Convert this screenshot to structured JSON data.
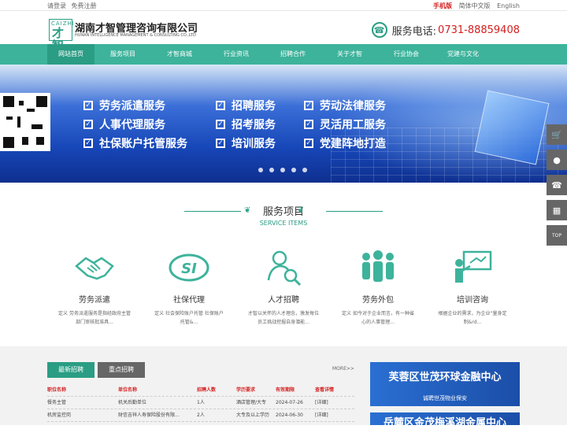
{
  "topbar": {
    "login": "请登录",
    "register": "免费注册",
    "mobile": "手机版",
    "lang_cn": "简体中文版",
    "lang_en": "English"
  },
  "logo": {
    "mark_text": "CAIZHI",
    "mark_cn": "才智",
    "name_cn": "湖南才智管理咨询有限公司",
    "name_en": "HUNAN INTELLIGENCE MANAGEMENT & CONSULTING CO.,LTD"
  },
  "hotline": {
    "label": "服务电话:",
    "number": "0731-88859408"
  },
  "nav": {
    "items": [
      "网站首页",
      "服务项目",
      "才智商城",
      "行业资讯",
      "招聘合作",
      "关于才智",
      "行业协会",
      "党建与文化"
    ]
  },
  "banner": {
    "rows": [
      [
        "劳务派遣服务",
        "招聘服务",
        "劳动法律服务"
      ],
      [
        "人事代理服务",
        "招考服务",
        "灵活用工服务"
      ],
      [
        "社保账户托管服务",
        "培训服务",
        "党建阵地打造"
      ]
    ],
    "slides": 5
  },
  "services": {
    "title_cn": "服务项目",
    "title_en": "SERVICE ITEMS",
    "items": [
      {
        "name": "劳务派遣",
        "desc": "定义 劳务派遣服务是指经政府主管部门审核批准具...",
        "icon": "handshake-icon"
      },
      {
        "name": "社保代理",
        "desc": "定义 社会保险账户托管 社保账户托管&...",
        "icon": "si-badge-icon"
      },
      {
        "name": "人才招聘",
        "desc": "才智以关怀的人才理念，激发每位员工挑战挖掘自身潜能...",
        "icon": "talent-search-icon"
      },
      {
        "name": "劳务外包",
        "desc": "定义 如今对于企业而言，有一种省心的人事管理...",
        "icon": "team-icon"
      },
      {
        "name": "培训咨询",
        "desc": "根据企业的需求，为企业“量身定制&rd...",
        "icon": "training-icon"
      }
    ]
  },
  "jobs": {
    "tab_latest": "最新招聘",
    "tab_key": "重点招聘",
    "more": "MORE>>",
    "columns": [
      "职位名称",
      "单位名称",
      "招聘人数",
      "学历要求",
      "有效期限",
      "查看详情"
    ],
    "rows": [
      [
        "餐务主管",
        "机关后勤单位",
        "1人",
        "酒店管理/大专",
        "2024-07-26",
        "[详细]"
      ],
      [
        "机房监控岗",
        "财信吉祥人寿保险股份有限...",
        "2人",
        "大专及以上学历",
        "2024-06-30",
        "[详细]"
      ]
    ]
  },
  "ads": [
    {
      "title": "芙蓉区世茂环球金融中心",
      "sub": "诚聘世茂物业保安"
    },
    {
      "title": "岳麓区金茂梅溪湖金属中心",
      "sub": ""
    }
  ],
  "sidebar": [
    "cart-icon",
    "qq-icon",
    "phone-icon",
    "qr-icon",
    "TOP"
  ],
  "colors": {
    "brand": "#2a9d84",
    "nav": "#3db39b",
    "accent_red": "#d42020"
  }
}
